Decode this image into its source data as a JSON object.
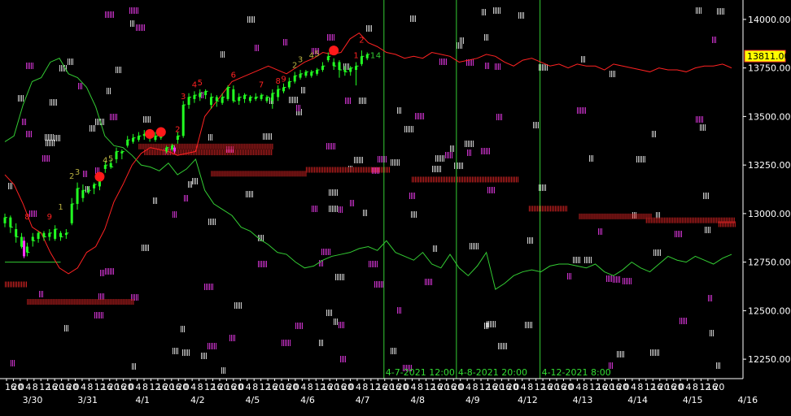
{
  "chart_data": {
    "type": "line",
    "ylim": [
      12150,
      14100
    ],
    "y_ticks": [
      "14000.00",
      "13750.00",
      "13500.00",
      "13250.00",
      "13000.00",
      "12750.00",
      "12500.00",
      "12250.00"
    ],
    "y_tick_values": [
      14000,
      13750,
      13500,
      13250,
      13000,
      12750,
      12500,
      12250
    ],
    "current_price": "13811.00",
    "current_price_value": 13811,
    "date_labels": [
      "3/30",
      "3/31",
      "4/1",
      "4/2",
      "4/5",
      "4/6",
      "4/7",
      "4/8",
      "4/9",
      "4/12",
      "4/13",
      "4/14",
      "4/15",
      "4/16"
    ],
    "hour_labels": [
      "16",
      "20",
      "0",
      "4",
      "8",
      "12",
      "16",
      "20"
    ],
    "vertical_markers": [
      {
        "label": "4-7-2021 12:00",
        "bar": 68
      },
      {
        "label": "4-8-2021 20:00",
        "bar": 81
      },
      {
        "label": "4-12-2021 8:00",
        "bar": 96
      }
    ],
    "series": [
      {
        "color": "#33cc33",
        "values": [
          13370,
          13400,
          13560,
          13680,
          13700,
          13780,
          13800,
          13720,
          13700,
          13650,
          13550,
          13400,
          13350,
          13340,
          13300,
          13250,
          13240,
          13220,
          13260,
          13200,
          13230,
          13280,
          13120,
          13050,
          13020,
          12990,
          12930,
          12910,
          12870,
          12840,
          12800,
          12790,
          12750,
          12720,
          12730,
          12760,
          12780,
          12790,
          12800,
          12820,
          12830,
          12810,
          12860,
          12800,
          12780,
          12760,
          12800,
          12740,
          12720,
          12790,
          12720,
          12680,
          12730,
          12800,
          12610,
          12640,
          12680,
          12700,
          12710,
          12700,
          12730,
          12740,
          12740,
          12730,
          12720,
          12740,
          12700,
          12680,
          12710,
          12750,
          12720,
          12700,
          12740,
          12780,
          12760,
          12750,
          12780,
          12760,
          12740,
          12770,
          12790
        ]
      },
      {
        "color": "#ff2222",
        "values": [
          13200,
          13150,
          13050,
          12930,
          12900,
          12800,
          12720,
          12690,
          12720,
          12800,
          12830,
          12920,
          13060,
          13150,
          13250,
          13310,
          13340,
          13330,
          13320,
          13300,
          13310,
          13320,
          13500,
          13560,
          13620,
          13680,
          13700,
          13720,
          13740,
          13760,
          13740,
          13720,
          13750,
          13780,
          13800,
          13830,
          13820,
          13830,
          13900,
          13930,
          13880,
          13860,
          13830,
          13820,
          13800,
          13810,
          13800,
          13830,
          13820,
          13810,
          13780,
          13790,
          13800,
          13820,
          13810,
          13780,
          13760,
          13790,
          13800,
          13780,
          13760,
          13770,
          13750,
          13770,
          13760,
          13760,
          13740,
          13770,
          13760,
          13750,
          13740,
          13730,
          13750,
          13740,
          13740,
          13730,
          13750,
          13760,
          13760,
          13770,
          13750
        ]
      }
    ],
    "candles": [
      {
        "i": 0,
        "o": 12950,
        "c": 12980,
        "h": 13000,
        "l": 12930
      },
      {
        "i": 1,
        "o": 12980,
        "c": 12930,
        "h": 12990,
        "l": 12900
      },
      {
        "i": 2,
        "o": 12920,
        "c": 12880,
        "h": 12950,
        "l": 12850
      },
      {
        "i": 3,
        "o": 12880,
        "c": 12830,
        "h": 12900,
        "l": 12820
      },
      {
        "i": 4,
        "o": 12830,
        "c": 12800,
        "h": 12850,
        "l": 12780
      },
      {
        "i": 5,
        "o": 12880,
        "c": 12860,
        "h": 12900,
        "l": 12830
      },
      {
        "i": 6,
        "o": 12870,
        "c": 12900,
        "h": 12910,
        "l": 12850
      },
      {
        "i": 7,
        "o": 12900,
        "c": 12880,
        "h": 12910,
        "l": 12860
      },
      {
        "i": 8,
        "o": 12880,
        "c": 12900,
        "h": 12920,
        "l": 12860
      },
      {
        "i": 9,
        "o": 12870,
        "c": 12920,
        "h": 12940,
        "l": 12860
      },
      {
        "i": 10,
        "o": 12900,
        "c": 12880,
        "h": 12910,
        "l": 12860
      },
      {
        "i": 11,
        "o": 12890,
        "c": 12900,
        "h": 12920,
        "l": 12870
      },
      {
        "i": 12,
        "o": 12950,
        "c": 13050,
        "h": 13080,
        "l": 12940
      },
      {
        "i": 13,
        "o": 13050,
        "c": 13130,
        "h": 13160,
        "l": 13020
      },
      {
        "i": 14,
        "o": 13080,
        "c": 13120,
        "h": 13150,
        "l": 13060
      },
      {
        "i": 15,
        "o": 13110,
        "c": 13120,
        "h": 13140,
        "l": 13100
      },
      {
        "i": 16,
        "o": 13130,
        "c": 13150,
        "h": 13160,
        "l": 13100
      },
      {
        "i": 17,
        "o": 13140,
        "c": 13180,
        "h": 13200,
        "l": 13120
      },
      {
        "i": 18,
        "o": 13230,
        "c": 13250,
        "h": 13270,
        "l": 13210
      },
      {
        "i": 19,
        "o": 13260,
        "c": 13240,
        "h": 13280,
        "l": 13230
      },
      {
        "i": 20,
        "o": 13280,
        "c": 13320,
        "h": 13340,
        "l": 13260
      },
      {
        "i": 21,
        "o": 13310,
        "c": 13320,
        "h": 13330,
        "l": 13280
      },
      {
        "i": 22,
        "o": 13350,
        "c": 13380,
        "h": 13400,
        "l": 13340
      },
      {
        "i": 23,
        "o": 13370,
        "c": 13390,
        "h": 13410,
        "l": 13360
      },
      {
        "i": 24,
        "o": 13380,
        "c": 13400,
        "h": 13420,
        "l": 13370
      },
      {
        "i": 25,
        "o": 13400,
        "c": 13410,
        "h": 13430,
        "l": 13380
      },
      {
        "i": 26,
        "o": 13390,
        "c": 13410,
        "h": 13420,
        "l": 13370
      },
      {
        "i": 27,
        "o": 13380,
        "c": 13400,
        "h": 13420,
        "l": 13370
      },
      {
        "i": 28,
        "o": 13390,
        "c": 13410,
        "h": 13420,
        "l": 13380
      },
      {
        "i": 29,
        "o": 13320,
        "c": 13340,
        "h": 13350,
        "l": 13310
      },
      {
        "i": 30,
        "o": 13330,
        "c": 13350,
        "h": 13360,
        "l": 13320
      },
      {
        "i": 31,
        "o": 13380,
        "c": 13400,
        "h": 13420,
        "l": 13360
      },
      {
        "i": 32,
        "o": 13400,
        "c": 13560,
        "h": 13580,
        "l": 13390
      },
      {
        "i": 33,
        "o": 13560,
        "c": 13600,
        "h": 13620,
        "l": 13540
      },
      {
        "i": 34,
        "o": 13590,
        "c": 13610,
        "h": 13630,
        "l": 13570
      },
      {
        "i": 35,
        "o": 13600,
        "c": 13620,
        "h": 13640,
        "l": 13580
      },
      {
        "i": 36,
        "o": 13610,
        "c": 13630,
        "h": 13640,
        "l": 13590
      },
      {
        "i": 37,
        "o": 13560,
        "c": 13600,
        "h": 13620,
        "l": 13540
      },
      {
        "i": 38,
        "o": 13600,
        "c": 13580,
        "h": 13610,
        "l": 13550
      },
      {
        "i": 39,
        "o": 13570,
        "c": 13600,
        "h": 13620,
        "l": 13560
      },
      {
        "i": 40,
        "o": 13590,
        "c": 13650,
        "h": 13660,
        "l": 13580
      },
      {
        "i": 41,
        "o": 13640,
        "c": 13580,
        "h": 13660,
        "l": 13570
      },
      {
        "i": 42,
        "o": 13580,
        "c": 13600,
        "h": 13620,
        "l": 13560
      },
      {
        "i": 43,
        "o": 13590,
        "c": 13610,
        "h": 13620,
        "l": 13570
      },
      {
        "i": 44,
        "o": 13580,
        "c": 13600,
        "h": 13610,
        "l": 13570
      },
      {
        "i": 45,
        "o": 13590,
        "c": 13600,
        "h": 13620,
        "l": 13580
      },
      {
        "i": 46,
        "o": 13590,
        "c": 13610,
        "h": 13620,
        "l": 13580
      },
      {
        "i": 47,
        "o": 13580,
        "c": 13600,
        "h": 13610,
        "l": 13570
      },
      {
        "i": 48,
        "o": 13580,
        "c": 13620,
        "h": 13640,
        "l": 13540
      },
      {
        "i": 49,
        "o": 13600,
        "c": 13640,
        "h": 13660,
        "l": 13580
      },
      {
        "i": 50,
        "o": 13630,
        "c": 13650,
        "h": 13670,
        "l": 13620
      },
      {
        "i": 51,
        "o": 13650,
        "c": 13680,
        "h": 13700,
        "l": 13640
      },
      {
        "i": 52,
        "o": 13680,
        "c": 13710,
        "h": 13730,
        "l": 13670
      },
      {
        "i": 53,
        "o": 13700,
        "c": 13720,
        "h": 13740,
        "l": 13690
      },
      {
        "i": 54,
        "o": 13710,
        "c": 13730,
        "h": 13740,
        "l": 13700
      },
      {
        "i": 55,
        "o": 13710,
        "c": 13730,
        "h": 13740,
        "l": 13700
      },
      {
        "i": 56,
        "o": 13720,
        "c": 13740,
        "h": 13750,
        "l": 13710
      },
      {
        "i": 57,
        "o": 13740,
        "c": 13760,
        "h": 13780,
        "l": 13730
      },
      {
        "i": 58,
        "o": 13790,
        "c": 13810,
        "h": 13830,
        "l": 13780
      },
      {
        "i": 59,
        "o": 13780,
        "c": 13760,
        "h": 13800,
        "l": 13740
      },
      {
        "i": 60,
        "o": 13780,
        "c": 13740,
        "h": 13790,
        "l": 13700
      },
      {
        "i": 61,
        "o": 13740,
        "c": 13730,
        "h": 13760,
        "l": 13710
      },
      {
        "i": 62,
        "o": 13730,
        "c": 13750,
        "h": 13760,
        "l": 13710
      },
      {
        "i": 63,
        "o": 13740,
        "c": 13760,
        "h": 13780,
        "l": 13660
      },
      {
        "i": 64,
        "o": 13770,
        "c": 13810,
        "h": 13840,
        "l": 13760
      },
      {
        "i": 65,
        "o": 13800,
        "c": 13820,
        "h": 13830,
        "l": 13790
      }
    ],
    "magenta_bars": [
      {
        "i": 3,
        "o": 12860,
        "c": 12780,
        "h": 12880,
        "l": 12770
      },
      {
        "i": 30,
        "o": 13340,
        "c": 13320,
        "h": 13350,
        "l": 13310
      }
    ],
    "red_dots": [
      {
        "i": 17,
        "v": 13190
      },
      {
        "i": 26,
        "v": 13410
      },
      {
        "i": 28,
        "v": 13420
      },
      {
        "i": 59,
        "v": 13840
      }
    ],
    "count_labels": [
      {
        "i": 4,
        "v": 12970,
        "text": "8",
        "cls": "count-red"
      },
      {
        "i": 8,
        "v": 12970,
        "text": "9",
        "cls": "count-red"
      },
      {
        "i": 10,
        "v": 13020,
        "text": "1",
        "cls": "count-olive"
      },
      {
        "i": 12,
        "v": 13180,
        "text": "2",
        "cls": "count-olive"
      },
      {
        "i": 13,
        "v": 13200,
        "text": "3",
        "cls": "count-olive"
      },
      {
        "i": 18,
        "v": 13260,
        "text": "4",
        "cls": "count-olive"
      },
      {
        "i": 19,
        "v": 13270,
        "text": "5",
        "cls": "count-olive"
      },
      {
        "i": 31,
        "v": 13420,
        "text": "2",
        "cls": "count-red"
      },
      {
        "i": 32,
        "v": 13590,
        "text": "3",
        "cls": "count-red"
      },
      {
        "i": 34,
        "v": 13650,
        "text": "4",
        "cls": "count-red"
      },
      {
        "i": 35,
        "v": 13660,
        "text": "5",
        "cls": "count-red"
      },
      {
        "i": 41,
        "v": 13700,
        "text": "6",
        "cls": "count-red"
      },
      {
        "i": 46,
        "v": 13650,
        "text": "7",
        "cls": "count-red"
      },
      {
        "i": 49,
        "v": 13670,
        "text": "8",
        "cls": "count-red"
      },
      {
        "i": 50,
        "v": 13680,
        "text": "9",
        "cls": "count-red"
      },
      {
        "i": 52,
        "v": 13750,
        "text": "2",
        "cls": "count-olive"
      },
      {
        "i": 53,
        "v": 13780,
        "text": "3",
        "cls": "count-olive"
      },
      {
        "i": 55,
        "v": 13800,
        "text": "4",
        "cls": "count-olive"
      },
      {
        "i": 56,
        "v": 13810,
        "text": "5",
        "cls": "count-olive"
      },
      {
        "i": 63,
        "v": 13800,
        "text": "1",
        "cls": "count-red"
      },
      {
        "i": 64,
        "v": 13880,
        "text": "2",
        "cls": "count-red"
      },
      {
        "i": 66,
        "v": 13800,
        "text": "1",
        "cls": "count-green"
      },
      {
        "i": 67,
        "v": 13800,
        "text": "4",
        "cls": "count-green"
      }
    ],
    "red_zones": [
      {
        "i0": 0,
        "i1": 4,
        "v": 12650
      },
      {
        "i0": 4,
        "i1": 23,
        "v": 12560
      },
      {
        "i0": 24,
        "i1": 48,
        "v": 13360
      },
      {
        "i0": 37,
        "i1": 54,
        "v": 13220
      },
      {
        "i0": 25,
        "i1": 48,
        "v": 13330
      },
      {
        "i0": 54,
        "i1": 69,
        "v": 13240
      },
      {
        "i0": 73,
        "i1": 92,
        "v": 13190
      },
      {
        "i0": 94,
        "i1": 101,
        "v": 13040
      },
      {
        "i0": 103,
        "i1": 116,
        "v": 13000
      },
      {
        "i0": 115,
        "i1": 131,
        "v": 12980
      },
      {
        "i0": 128,
        "i1": 131,
        "v": 12960
      }
    ],
    "green_ref": {
      "i0": 0,
      "i1": 10,
      "v": 12750
    }
  }
}
